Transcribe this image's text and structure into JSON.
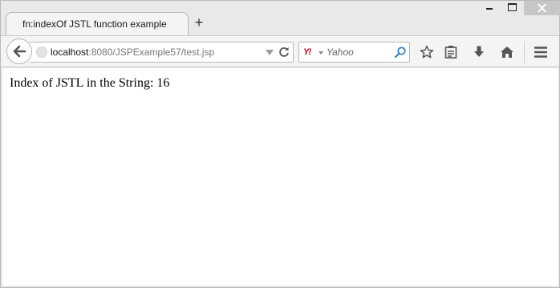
{
  "window": {
    "tab_title": "fn:indexOf JSTL function example",
    "new_tab_label": "+"
  },
  "navbar": {
    "url_host": "localhost",
    "url_path": ":8080/JSPExample57/test.jsp",
    "search_engine_logo": "Y!",
    "search_placeholder": "Yahoo",
    "icons": [
      "back-arrow-icon",
      "globe-icon",
      "dropdown-icon",
      "reload-icon",
      "yahoo-icon",
      "search-icon",
      "star-icon",
      "reading-list-icon",
      "download-icon",
      "home-icon",
      "menu-icon"
    ]
  },
  "content": {
    "text": "Index of JSTL in the String: 16"
  }
}
